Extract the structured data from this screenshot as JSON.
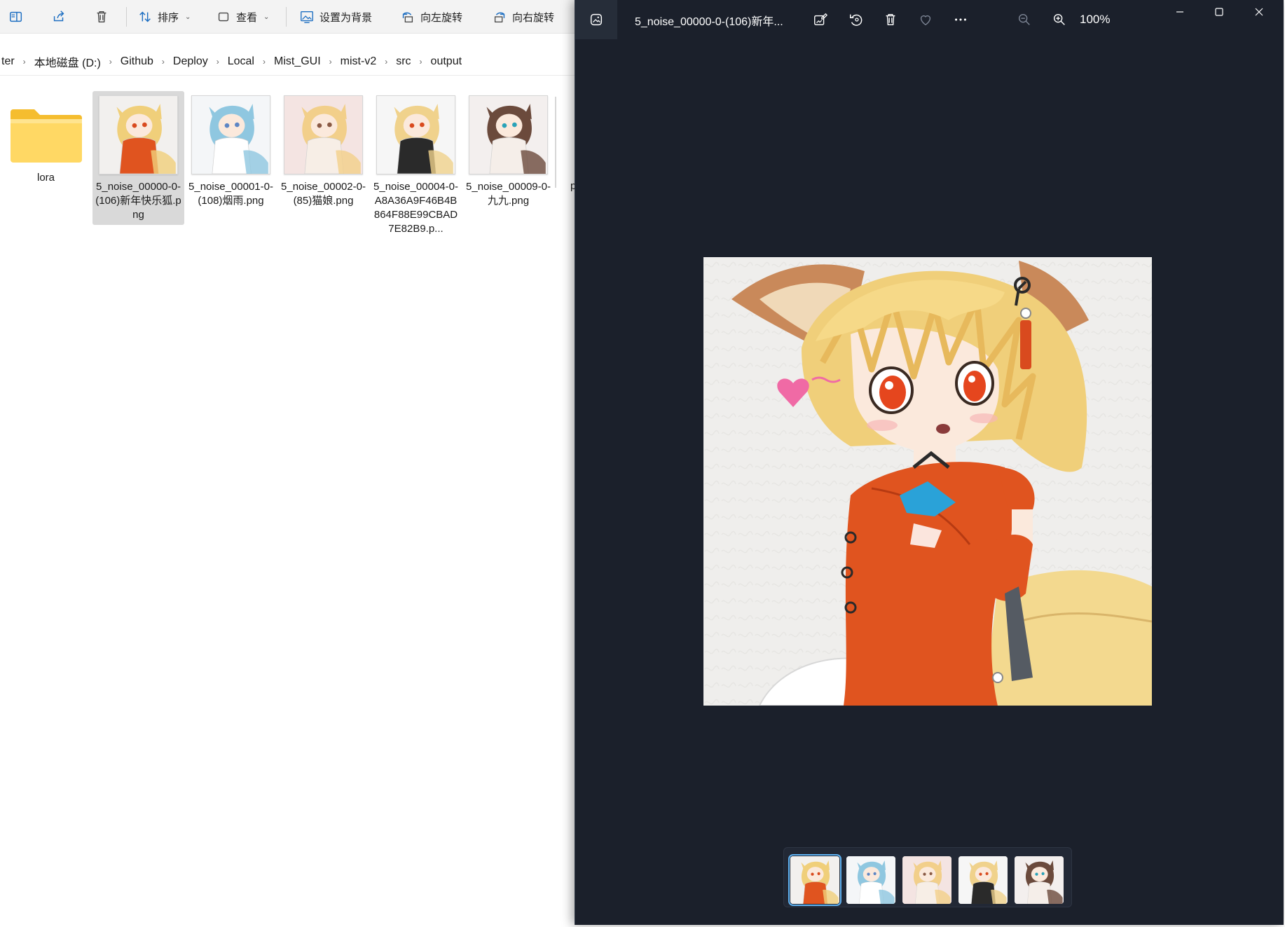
{
  "explorer": {
    "toolbar": {
      "sort_label": "排序",
      "view_label": "查看",
      "set_background_label": "设置为背景",
      "rotate_left_label": "向左旋转",
      "rotate_right_label": "向右旋转"
    },
    "breadcrumb": [
      "ter",
      "本地磁盘 (D:)",
      "Github",
      "Deploy",
      "Local",
      "Mist_GUI",
      "mist-v2",
      "src",
      "output"
    ],
    "items": [
      {
        "type": "folder",
        "name": "lora"
      },
      {
        "type": "image",
        "name": "5_noise_00000-0-(106)新年快乐狐.png",
        "selected": true,
        "thumb": "orange"
      },
      {
        "type": "image",
        "name": "5_noise_00001-0-(108)烟雨.png",
        "thumb": "blue"
      },
      {
        "type": "image",
        "name": "5_noise_00002-0-(85)猫娘.png",
        "thumb": "pink"
      },
      {
        "type": "image",
        "name": "5_noise_00004-0-A8A36A9F46B4B864F88E99CBAD7E82B9.p...",
        "thumb": "bw"
      },
      {
        "type": "image",
        "name": "5_noise_00009-0-九九.png",
        "thumb": "brown"
      }
    ],
    "partial_item_label": "p"
  },
  "viewer": {
    "title": "5_noise_00000-0-(106)新年...",
    "zoom": "100%",
    "filmstrip": [
      "orange",
      "blue",
      "pink",
      "bw",
      "brown"
    ],
    "active_index": 0,
    "colors": {
      "background": "#1b202b",
      "accent": "#5fb2f2",
      "dress": "#e0541f",
      "hair": "#f0cf7a",
      "eyes": "#e5461e",
      "heart": "#f06aa5"
    }
  }
}
